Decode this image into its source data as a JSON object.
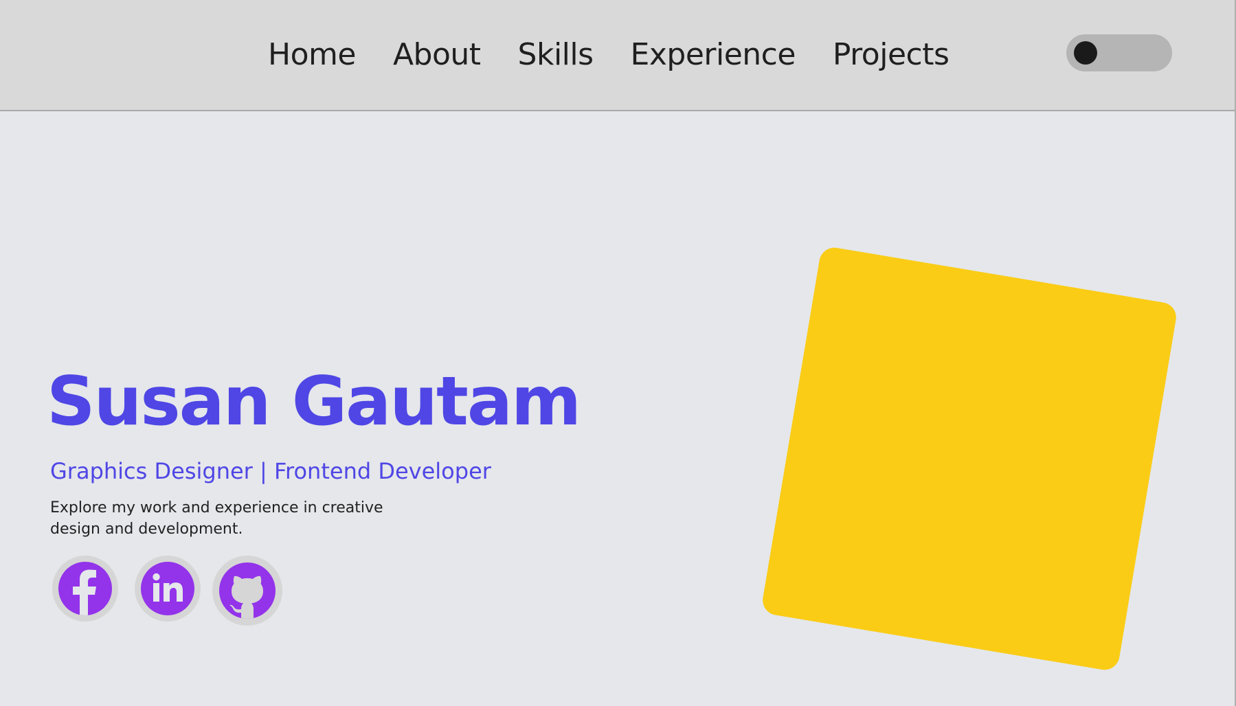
{
  "nav": {
    "items": [
      {
        "label": "Home"
      },
      {
        "label": "About"
      },
      {
        "label": "Skills"
      },
      {
        "label": "Experience"
      },
      {
        "label": "Projects"
      }
    ]
  },
  "theme_toggle": {
    "state": "off"
  },
  "hero": {
    "name": "Susan Gautam",
    "role": "Graphics Designer | Frontend Developer",
    "description": "Explore my work and experience in creative design and development."
  },
  "socials": [
    {
      "icon": "facebook-icon"
    },
    {
      "icon": "linkedin-icon"
    },
    {
      "icon": "github-icon"
    }
  ],
  "colors": {
    "accent": "#4f46e5",
    "social": "#9333ea",
    "card": "#facc15",
    "header_bg": "#d9d9d9",
    "page_bg": "#e5e7eb"
  }
}
